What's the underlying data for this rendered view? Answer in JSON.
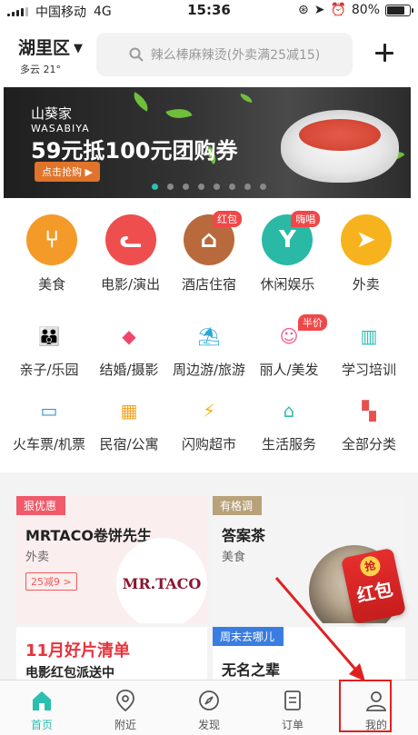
{
  "status": {
    "carrier": "中国移动",
    "network": "4G",
    "time": "15:36",
    "battery": "80%"
  },
  "header": {
    "city": "湖里区",
    "weather": "多云 21°",
    "search_placeholder": "辣么棒麻辣烫(外卖满25减15)"
  },
  "banner": {
    "brand_cn": "山葵家",
    "brand_en": "WASABIYA",
    "headline": "59元抵100元团购券",
    "cta": "点击抢购 ▶",
    "dot_count": 8,
    "active_dot": 0
  },
  "categories": [
    {
      "label": "美食",
      "color": "#f39a28",
      "icon": "fork-knife-icon",
      "tag": ""
    },
    {
      "label": "电影/演出",
      "color": "#ee4e4e",
      "icon": "cat-icon",
      "tag": ""
    },
    {
      "label": "酒店住宿",
      "color": "#b86a3c",
      "icon": "hotel-icon",
      "tag": "红包"
    },
    {
      "label": "休闲娱乐",
      "color": "#29b9a5",
      "icon": "cocktail-icon",
      "tag": "嗨唱"
    },
    {
      "label": "外卖",
      "color": "#f6b31e",
      "icon": "delivery-icon",
      "tag": ""
    }
  ],
  "row2": [
    {
      "label": "亲子/乐园",
      "color": "#f45c6b",
      "icon": "family-icon",
      "tag": ""
    },
    {
      "label": "结婚/摄影",
      "color": "#f3456a",
      "icon": "diamond-icon",
      "tag": ""
    },
    {
      "label": "周边游/旅游",
      "color": "#27a8d8",
      "icon": "palm-icon",
      "tag": ""
    },
    {
      "label": "丽人/美发",
      "color": "#f25a8d",
      "icon": "beauty-icon",
      "tag": "半价"
    },
    {
      "label": "学习培训",
      "color": "#2bbfb0",
      "icon": "book-icon",
      "tag": ""
    }
  ],
  "row3": [
    {
      "label": "火车票/机票",
      "color": "#3a8fe0",
      "icon": "train-icon"
    },
    {
      "label": "民宿/公寓",
      "color": "#f2a624",
      "icon": "building-icon"
    },
    {
      "label": "闪购超市",
      "color": "#f4b520",
      "icon": "lightning-icon"
    },
    {
      "label": "生活服务",
      "color": "#2bbfb0",
      "icon": "house-icon"
    },
    {
      "label": "全部分类",
      "color": "#e8504e",
      "icon": "grid-icon"
    }
  ],
  "cards": {
    "c1": {
      "badge": "狠优惠",
      "title": "MRTACO卷饼先生",
      "sub": "外卖",
      "coupon": "25减9 >",
      "logo": "MR.TACO"
    },
    "c2": {
      "badge": "有格调",
      "title": "答案茶",
      "sub": "美食"
    },
    "c3": {
      "title": "11月好片清单",
      "sub": "电影红包派送中"
    },
    "c4": {
      "badge": "周末去哪儿",
      "title": "无名之辈"
    },
    "redbag": {
      "small": "抢",
      "big": "红包"
    }
  },
  "tabs": [
    {
      "label": "首页",
      "icon": "home-icon",
      "active": true
    },
    {
      "label": "附近",
      "icon": "location-icon",
      "active": false
    },
    {
      "label": "发现",
      "icon": "compass-icon",
      "active": false
    },
    {
      "label": "订单",
      "icon": "order-icon",
      "active": false
    },
    {
      "label": "我的",
      "icon": "user-icon",
      "active": false
    }
  ]
}
